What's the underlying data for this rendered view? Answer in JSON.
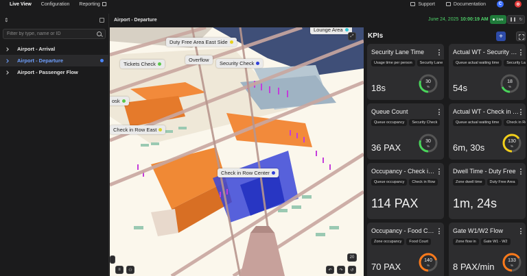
{
  "nav": {
    "live_view": "Live View",
    "configuration": "Configuration",
    "reporting": "Reporting",
    "support": "Support",
    "documentation": "Documentation",
    "avatar_initial": "C"
  },
  "sidebar": {
    "search_placeholder": "Filter by type, name or ID",
    "items": [
      {
        "label": "Airport - Arrival"
      },
      {
        "label": "Airport - Departure"
      },
      {
        "label": "Airport - Passenger Flow"
      }
    ]
  },
  "map": {
    "title": "Airport - Departure",
    "zoom": "20",
    "labels": [
      {
        "text": "Lounge Area",
        "color": "#30c8d8"
      },
      {
        "text": "Duty Free Area East Side",
        "color": "#e8d21c"
      },
      {
        "text": "Overflow",
        "color": ""
      },
      {
        "text": "Tickets Check",
        "color": "#5cc84a"
      },
      {
        "text": "Security Check",
        "color": "#2f3fd8"
      },
      {
        "text": "osk",
        "color": "#5cc84a"
      },
      {
        "text": "Check in Row East",
        "color": "#d8d22a"
      },
      {
        "text": "Check in Row Center",
        "color": "#2f3fd8"
      }
    ]
  },
  "header": {
    "date": "June 24, 2025",
    "time": "10:00:19 AM",
    "live_label": "Live"
  },
  "kpis": {
    "title": "KPIs",
    "cards": [
      {
        "title": "Security Lane Time",
        "tags": [
          "Usage time per person",
          "Security Lane"
        ],
        "value": "18s",
        "gauge": "30",
        "gauge_color": "#48d65a",
        "gauge_fraction": 0.3
      },
      {
        "title": "Actual WT - Security Lane",
        "tags": [
          "Queue actual waiting time",
          "Security Lane"
        ],
        "value": "54s",
        "gauge": "18",
        "gauge_color": "#48d65a",
        "gauge_fraction": 0.18
      },
      {
        "title": "Queue Count",
        "tags": [
          "Queue occupancy",
          "Security Check"
        ],
        "value": "36 PAX",
        "gauge": "30",
        "gauge_color": "#48d65a",
        "gauge_fraction": 0.3
      },
      {
        "title": "Actual WT - Check in Row",
        "tags": [
          "Queue actual waiting time",
          "Check in Row"
        ],
        "value": "6m, 30s",
        "gauge": "130",
        "gauge_color": "#f2cf1a",
        "gauge_fraction": 0.65
      },
      {
        "title": "Occupancy - Check in Row",
        "tags": [
          "Queue occupancy",
          "Check in Row"
        ],
        "value": "114 PAX",
        "gauge": "",
        "gauge_color": "",
        "gauge_fraction": 0
      },
      {
        "title": "Dwell Time - Duty Free",
        "tags": [
          "Zone dwell time",
          "Duty Free Area"
        ],
        "value": "1m, 24s",
        "gauge": "",
        "gauge_color": "",
        "gauge_fraction": 0
      },
      {
        "title": "Occupancy - Food Court",
        "tags": [
          "Zone occupancy",
          "Food Court"
        ],
        "value": "70 PAX",
        "gauge": "140",
        "gauge_color": "#ff7a1a",
        "gauge_fraction": 0.7
      },
      {
        "title": "Gate W1/W2 Flow",
        "tags": [
          "Zone flow in",
          "Gate W1 - W2"
        ],
        "value": "8 PAX/min",
        "gauge": "133",
        "gauge_color": "#ff7a1a",
        "gauge_fraction": 0.66
      }
    ],
    "gauge_unit": "%"
  }
}
